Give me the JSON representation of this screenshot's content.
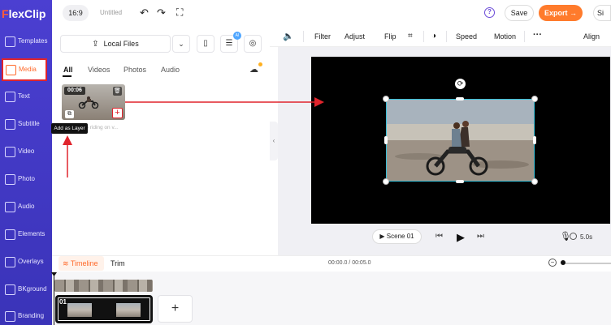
{
  "app": {
    "logo_text": "lexClip",
    "logo_f": "F"
  },
  "topbar": {
    "aspect_ratio": "16:9",
    "project_title": "Untitled",
    "help_glyph": "?",
    "save_label": "Save",
    "export_label": "Export →",
    "avatar_text": "Si"
  },
  "sidebar": {
    "items": [
      {
        "label": "Templates",
        "icon": "layers-icon"
      },
      {
        "label": "Media",
        "icon": "folder-icon",
        "active": true
      },
      {
        "label": "Text",
        "icon": "text-icon"
      },
      {
        "label": "Subtitle",
        "icon": "subtitle-icon"
      },
      {
        "label": "Video",
        "icon": "video-icon"
      },
      {
        "label": "Photo",
        "icon": "photo-icon"
      },
      {
        "label": "Audio",
        "icon": "music-icon"
      },
      {
        "label": "Elements",
        "icon": "elements-icon"
      },
      {
        "label": "Overlays",
        "icon": "overlays-icon"
      },
      {
        "label": "BKground",
        "icon": "background-icon"
      },
      {
        "label": "Branding",
        "icon": "branding-icon"
      }
    ]
  },
  "media_panel": {
    "local_files_label": "Local Files",
    "tabs": [
      "All",
      "Videos",
      "Photos",
      "Audio"
    ],
    "ai_badge": "AI",
    "item": {
      "duration": "00:06",
      "caption": "Two riding on v...",
      "tooltip": "Add as Layer"
    }
  },
  "edit_toolbar": {
    "items": [
      "Filter",
      "Adjust",
      "Flip",
      "Speed",
      "Motion",
      "Align"
    ]
  },
  "player": {
    "scene_label": "Scene 01",
    "duration": "5.0s"
  },
  "timeline": {
    "tabs": [
      "Timeline",
      "Trim"
    ],
    "time_display": "00:00.0 / 00:05.0",
    "scene_number": "01"
  },
  "colors": {
    "sidebar": "#4b3fd1",
    "accent": "#ff7b2c",
    "annotation": "#e0242c",
    "selection": "#39c0d8"
  }
}
